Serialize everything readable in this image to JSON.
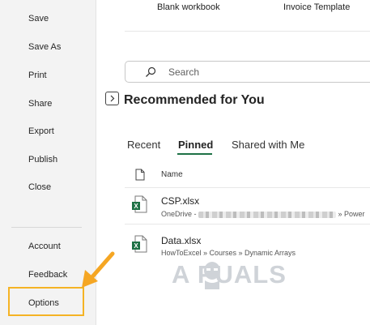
{
  "sidebar": {
    "items": [
      "Save",
      "Save As",
      "Print",
      "Share",
      "Export",
      "Publish",
      "Close"
    ],
    "bottom_items": [
      "Account",
      "Feedback",
      "Options"
    ]
  },
  "templates": {
    "blank_label": "Blank workbook",
    "invoice_label": "Invoice Template"
  },
  "search": {
    "placeholder": "Search"
  },
  "recommended": {
    "title": "Recommended for You"
  },
  "tabs": [
    "Recent",
    "Pinned",
    "Shared with Me"
  ],
  "file_list": {
    "column_name": "Name",
    "files": [
      {
        "name": "CSP.xlsx",
        "path_prefix": "OneDrive - ",
        "path_suffix": " » Power"
      },
      {
        "name": "Data.xlsx",
        "path": "HowToExcel » Courses » Dynamic Arrays"
      }
    ]
  },
  "watermark": {
    "text": "A  PUALS"
  },
  "colors": {
    "highlight": "#f5b324",
    "excel_green": "#1e7145",
    "accent_underline": "#1e7145"
  }
}
